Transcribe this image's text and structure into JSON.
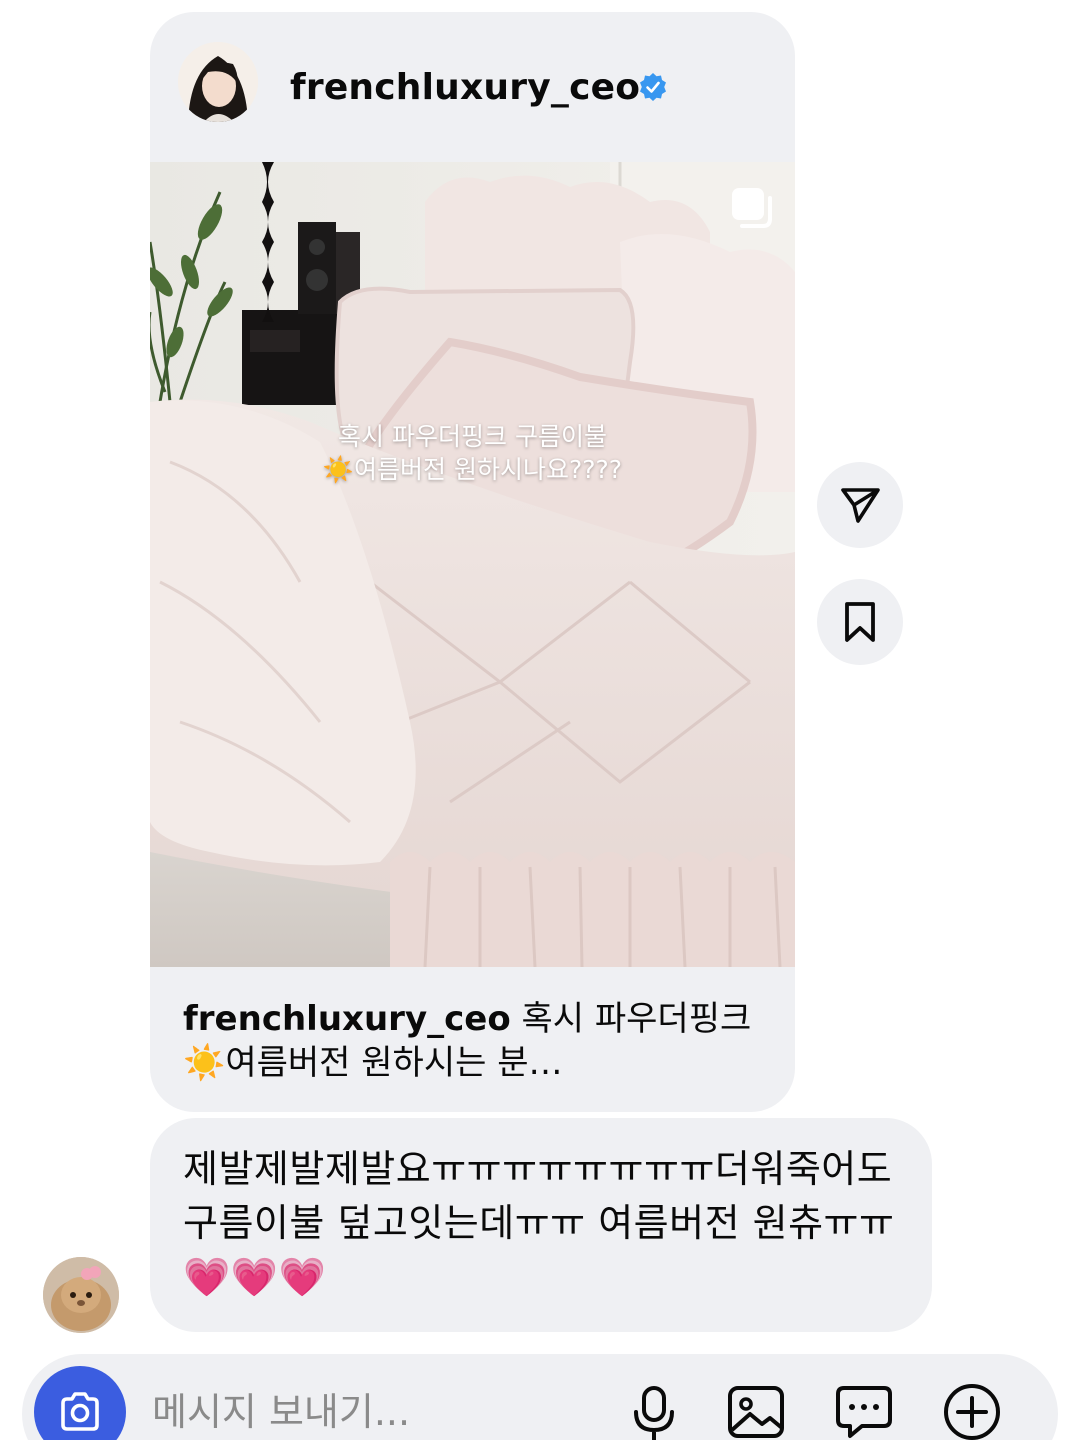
{
  "post": {
    "username": "frenchluxury_ceo",
    "verified": true,
    "story_text_line1": "혹시 파우더핑크 구름이불",
    "story_text_line2": "☀️여름버전 원하시나요????",
    "caption_user": "frenchluxury_ceo",
    "caption_text": " 혹시 파우더핑크 ☀️여름버전 원하시는 분…"
  },
  "reply": {
    "text": "제발제발제발요ㅠㅠㅠㅠㅠㅠㅠㅠ더워죽어도 구름이불 덮고잇는데ㅠㅠ 여름버전 원츄ㅠㅠ💗💗💗"
  },
  "composer": {
    "placeholder": "메시지 보내기..."
  },
  "icons": {
    "share": "paper-plane-icon",
    "save": "bookmark-icon",
    "camera": "camera-icon",
    "mic": "microphone-icon",
    "gallery": "image-icon",
    "sticker": "chat-bubble-icon",
    "add": "plus-circle-icon"
  },
  "colors": {
    "bubble": "#eff0f3",
    "accent": "#3b5de0",
    "verified": "#3897f0"
  }
}
